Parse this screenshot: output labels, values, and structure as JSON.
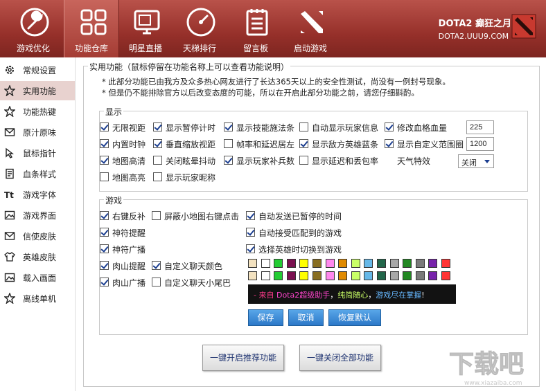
{
  "nav": [
    {
      "label": "游戏优化",
      "icon": "wrench-icon"
    },
    {
      "label": "功能仓库",
      "icon": "grid-icon"
    },
    {
      "label": "明星直播",
      "icon": "tv-icon"
    },
    {
      "label": "天梯排行",
      "icon": "gauge-icon"
    },
    {
      "label": "留言板",
      "icon": "notepad-icon"
    },
    {
      "label": "启动游戏",
      "icon": "dota-icon"
    }
  ],
  "brand": {
    "title": "DOTA2 癫狂之月",
    "url": "DOTA2.UUU9.COM"
  },
  "sidebar": [
    {
      "label": "常规设置",
      "icon": "gear-icon"
    },
    {
      "label": "实用功能",
      "icon": "star-icon"
    },
    {
      "label": "功能热键",
      "icon": "star-icon"
    },
    {
      "label": "原汁原味",
      "icon": "mail-icon"
    },
    {
      "label": "鼠标指针",
      "icon": "cursor-icon"
    },
    {
      "label": "血条样式",
      "icon": "list-icon"
    },
    {
      "label": "游戏字体",
      "icon": "font-icon"
    },
    {
      "label": "游戏界面",
      "icon": "image-icon"
    },
    {
      "label": "信使皮肤",
      "icon": "envelope-icon"
    },
    {
      "label": "英雄皮肤",
      "icon": "shirt-icon"
    },
    {
      "label": "载入画面",
      "icon": "image-icon"
    },
    {
      "label": "离线单机",
      "icon": "star-icon"
    }
  ],
  "panel": {
    "title": "实用功能（鼠标停留在功能名称上可以查看功能说明）",
    "note1": "*  此部分功能已由我方及众多热心网友进行了长达365天以上的安全性测试，尚没有一例封号现象。",
    "note2": "*  但是仍不能排除官方以后改变态度的可能，所以在开启此部分功能之前，请您仔细斟酌。"
  },
  "display": {
    "legend": "显示",
    "options": [
      {
        "label": "无限视距",
        "checked": true
      },
      {
        "label": "显示暂停计时",
        "checked": true
      },
      {
        "label": "显示技能施法条",
        "checked": true
      },
      {
        "label": "自动显示玩家信息",
        "checked": false
      },
      {
        "label": "修改血格血量",
        "checked": true
      },
      {
        "label": "内置时钟",
        "checked": true
      },
      {
        "label": "垂直缩放视距",
        "checked": true
      },
      {
        "label": "帧率和延迟居左",
        "checked": false
      },
      {
        "label": "显示敌方英雄蓝条",
        "checked": true
      },
      {
        "label": "显示自定义范围圈",
        "checked": true
      },
      {
        "label": "地图高清",
        "checked": true
      },
      {
        "label": "关闭眩晕抖动",
        "checked": false
      },
      {
        "label": "显示玩家补兵数",
        "checked": true
      },
      {
        "label": "显示延迟和丢包率",
        "checked": false
      },
      {
        "label": "地图高亮",
        "checked": false
      },
      {
        "label": "显示玩家昵称",
        "checked": false
      }
    ],
    "hp_value": "225",
    "range_value": "1200",
    "weather_label": "天气特效",
    "weather_value": "关闭"
  },
  "game": {
    "legend": "游戏",
    "options": [
      {
        "label": "右键反补",
        "checked": true
      },
      {
        "label": "屏蔽小地图右键点击",
        "checked": false
      },
      {
        "label": "自动发送已暂停的时间",
        "checked": true
      },
      {
        "label": "神符提醒",
        "checked": true
      },
      {
        "label": "自动接受匹配到的游戏",
        "checked": true
      },
      {
        "label": "神符广播",
        "checked": true
      },
      {
        "label": "选择英雄时切换到游戏",
        "checked": true
      },
      {
        "label": "肉山提醒",
        "checked": true
      },
      {
        "label": "自定义聊天颜色",
        "checked": true
      },
      {
        "label": "肉山广播",
        "checked": true
      },
      {
        "label": "自定义聊天小尾巴",
        "checked": false
      }
    ],
    "colors_row1": [
      "#f3e2c0",
      "#ffffff",
      "#22cc33",
      "#7a1050",
      "#ffff00",
      "#886e22",
      "#ff88ee",
      "#e08a00",
      "#c9ff66",
      "#66b8e8",
      "#22664a",
      "#a8a8a8",
      "#228822",
      "#7a7a7a",
      "#7722aa",
      "#ff3333"
    ],
    "colors_row2": [
      "#f3e2c0",
      "#ffffff",
      "#22cc33",
      "#7a1050",
      "#ffff00",
      "#886e22",
      "#ff88ee",
      "#e08a00",
      "#c9ff66",
      "#66b8e8",
      "#22664a",
      "#a8a8a8",
      "#228822",
      "#7a7a7a",
      "#7722aa",
      "#ff3333"
    ],
    "preview": {
      "p1": "- 来自 ",
      "p2": "Dota2超级助手",
      "p3": "，",
      "p4": "纯简随心",
      "p5": "，",
      "p6": "游戏尽在掌握",
      "p7": "!"
    },
    "save_label": "保存",
    "cancel_label": "取消",
    "reset_label": "恢复默认"
  },
  "actions": {
    "enable_label": "一键开启推荐功能",
    "disable_label": "一键关闭全部功能"
  }
}
